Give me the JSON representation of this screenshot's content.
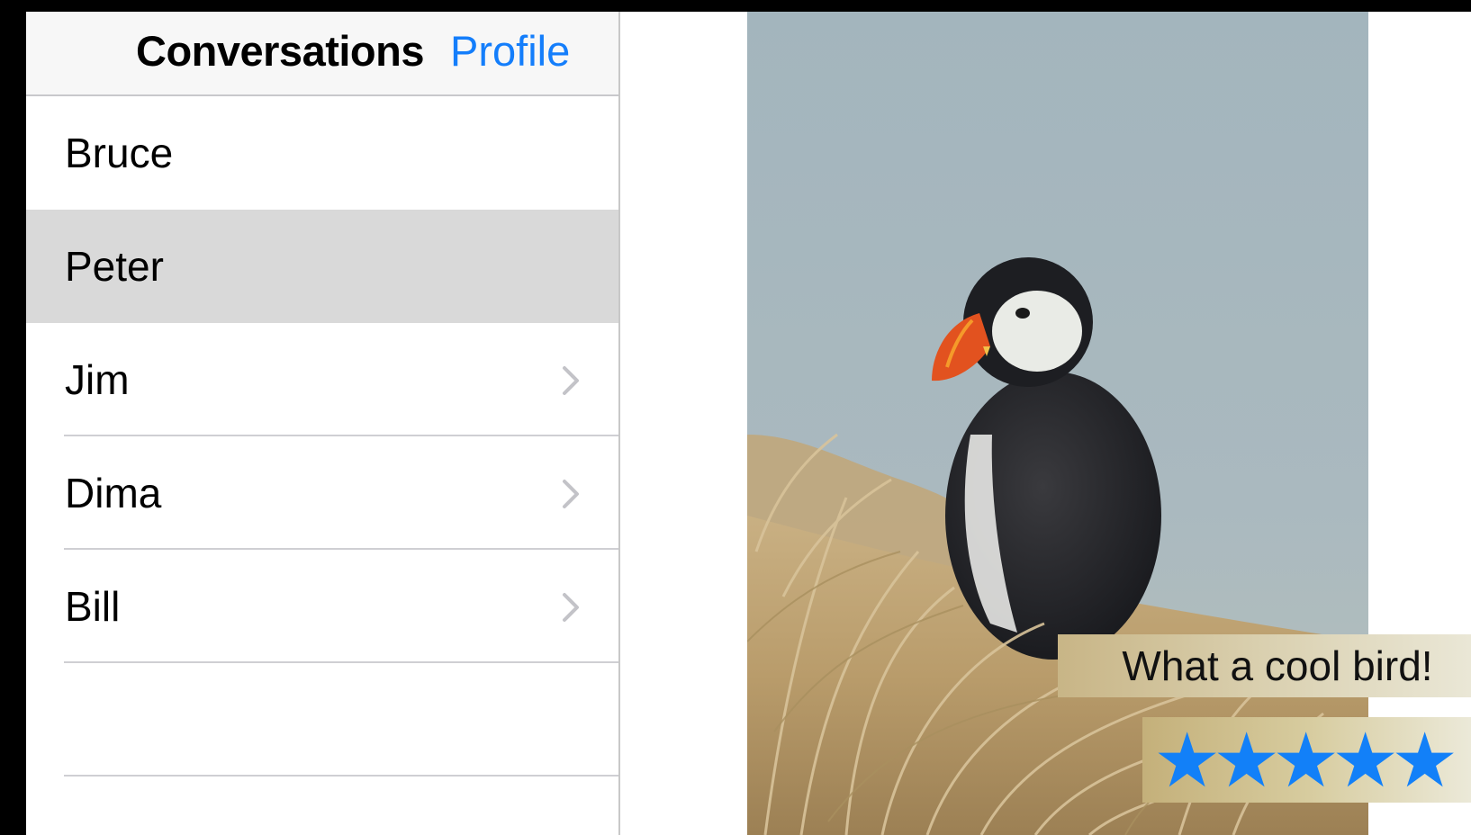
{
  "navbar": {
    "title": "Conversations",
    "profile_button": "Profile"
  },
  "conversations": [
    {
      "name": "Bruce",
      "selected": false,
      "chevron": false
    },
    {
      "name": "Peter",
      "selected": true,
      "chevron": false
    },
    {
      "name": "Jim",
      "selected": false,
      "chevron": true
    },
    {
      "name": "Dima",
      "selected": false,
      "chevron": true
    },
    {
      "name": "Bill",
      "selected": false,
      "chevron": true
    }
  ],
  "detail": {
    "photo": "puffin-photo",
    "caption": "What a cool bird!",
    "rating": {
      "value": 5,
      "max": 5,
      "icon": "star-icon"
    }
  },
  "colors": {
    "accent": "#147efb",
    "selected_row": "#d9d9d9",
    "star": "#1280f8"
  }
}
